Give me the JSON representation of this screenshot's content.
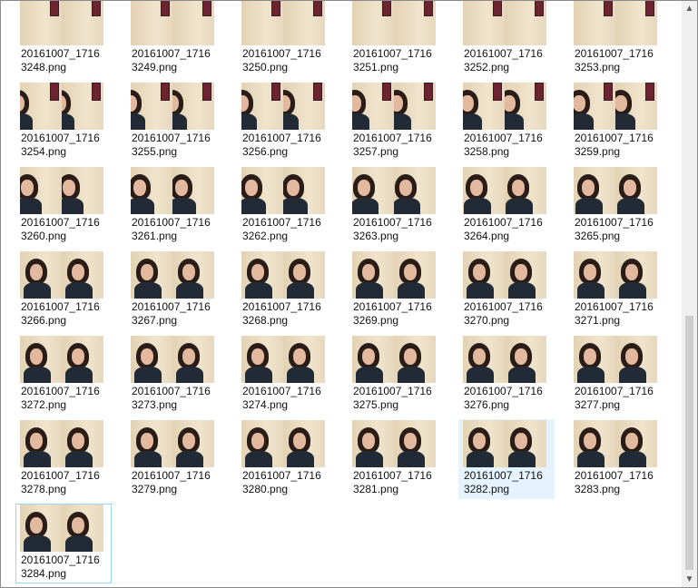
{
  "files": [
    {
      "name": "20161007_171632 48.png",
      "label_line1": "20161007_1716",
      "label_line2": "3248.png"
    },
    {
      "name": "",
      "label_line1": "20161007_1716",
      "label_line2": "3249.png"
    },
    {
      "name": "",
      "label_line1": "20161007_1716",
      "label_line2": "3250.png"
    },
    {
      "name": "",
      "label_line1": "20161007_1716",
      "label_line2": "3251.png"
    },
    {
      "name": "",
      "label_line1": "20161007_1716",
      "label_line2": "3252.png"
    },
    {
      "name": "",
      "label_line1": "20161007_1716",
      "label_line2": "3253.png"
    },
    {
      "name": "",
      "label_line1": "20161007_1716",
      "label_line2": "3254.png"
    },
    {
      "name": "",
      "label_line1": "20161007_1716",
      "label_line2": "3255.png"
    },
    {
      "name": "",
      "label_line1": "20161007_1716",
      "label_line2": "3256.png"
    },
    {
      "name": "",
      "label_line1": "20161007_1716",
      "label_line2": "3257.png"
    },
    {
      "name": "",
      "label_line1": "20161007_1716",
      "label_line2": "3258.png"
    },
    {
      "name": "",
      "label_line1": "20161007_1716",
      "label_line2": "3259.png"
    },
    {
      "name": "",
      "label_line1": "20161007_1716",
      "label_line2": "3260.png"
    },
    {
      "name": "",
      "label_line1": "20161007_1716",
      "label_line2": "3261.png"
    },
    {
      "name": "",
      "label_line1": "20161007_1716",
      "label_line2": "3262.png"
    },
    {
      "name": "",
      "label_line1": "20161007_1716",
      "label_line2": "3263.png"
    },
    {
      "name": "",
      "label_line1": "20161007_1716",
      "label_line2": "3264.png"
    },
    {
      "name": "",
      "label_line1": "20161007_1716",
      "label_line2": "3265.png"
    },
    {
      "name": "",
      "label_line1": "20161007_1716",
      "label_line2": "3266.png"
    },
    {
      "name": "",
      "label_line1": "20161007_1716",
      "label_line2": "3267.png"
    },
    {
      "name": "",
      "label_line1": "20161007_1716",
      "label_line2": "3268.png"
    },
    {
      "name": "",
      "label_line1": "20161007_1716",
      "label_line2": "3269.png"
    },
    {
      "name": "",
      "label_line1": "20161007_1716",
      "label_line2": "3270.png"
    },
    {
      "name": "",
      "label_line1": "20161007_1716",
      "label_line2": "3271.png"
    },
    {
      "name": "",
      "label_line1": "20161007_1716",
      "label_line2": "3272.png"
    },
    {
      "name": "",
      "label_line1": "20161007_1716",
      "label_line2": "3273.png"
    },
    {
      "name": "",
      "label_line1": "20161007_1716",
      "label_line2": "3274.png"
    },
    {
      "name": "",
      "label_line1": "20161007_1716",
      "label_line2": "3275.png"
    },
    {
      "name": "",
      "label_line1": "20161007_1716",
      "label_line2": "3276.png"
    },
    {
      "name": "",
      "label_line1": "20161007_1716",
      "label_line2": "3277.png"
    },
    {
      "name": "",
      "label_line1": "20161007_1716",
      "label_line2": "3278.png"
    },
    {
      "name": "",
      "label_line1": "20161007_1716",
      "label_line2": "3279.png"
    },
    {
      "name": "",
      "label_line1": "20161007_1716",
      "label_line2": "3280.png"
    },
    {
      "name": "",
      "label_line1": "20161007_1716",
      "label_line2": "3281.png"
    },
    {
      "name": "",
      "label_line1": "20161007_1716",
      "label_line2": "3282.png",
      "state": "hover"
    },
    {
      "name": "",
      "label_line1": "20161007_1716",
      "label_line2": "3283.png"
    },
    {
      "name": "",
      "label_line1": "20161007_1716",
      "label_line2": "3284.png",
      "state": "focused"
    }
  ],
  "thumb_watermark": "",
  "scrollbar": {
    "up_icon": "chevron-up-icon",
    "down_icon": "chevron-down-icon",
    "position_fraction": 0.55
  },
  "colors": {
    "hover_bg": "#e5f3ff",
    "focus_border": "#99d1ff",
    "thumb_bg": "#e9dbc1"
  }
}
